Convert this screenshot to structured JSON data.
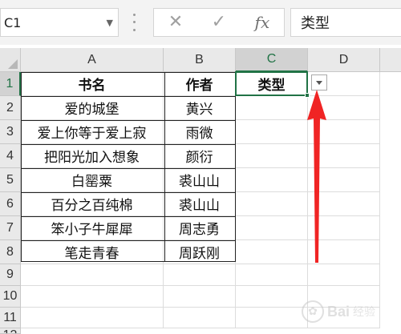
{
  "formula_bar": {
    "name_box": "C1",
    "cancel_icon": "close-icon",
    "enter_icon": "check-icon",
    "fx_label": "fx",
    "content": "类型"
  },
  "columns": [
    "A",
    "B",
    "C",
    "D"
  ],
  "rows": [
    "1",
    "2",
    "3",
    "4",
    "5",
    "6",
    "7",
    "8",
    "9",
    "10",
    "11",
    "12"
  ],
  "selected_cell": "C1",
  "cells": {
    "A1": "书名",
    "B1": "作者",
    "C1": "类型",
    "A2": "爱的城堡",
    "B2": "黄兴",
    "A3": "爱上你等于爱上寂",
    "B3": "雨微",
    "A4": "把阳光加入想象",
    "B4": "颜衍",
    "A5": "白罂粟",
    "B5": "裘山山",
    "A6": "百分之百纯棉",
    "B6": "裘山山",
    "A7": "笨小子牛犀犀",
    "B7": "周志勇",
    "A8": "笔走青春",
    "B8": "周跃刚"
  },
  "annotation": {
    "arrow_color": "#f02424"
  },
  "watermark": {
    "text": "Bai",
    "sub": "经验"
  },
  "colors": {
    "accent": "#217346",
    "header_bg": "#e9e9e9",
    "arrow": "#f02424"
  }
}
